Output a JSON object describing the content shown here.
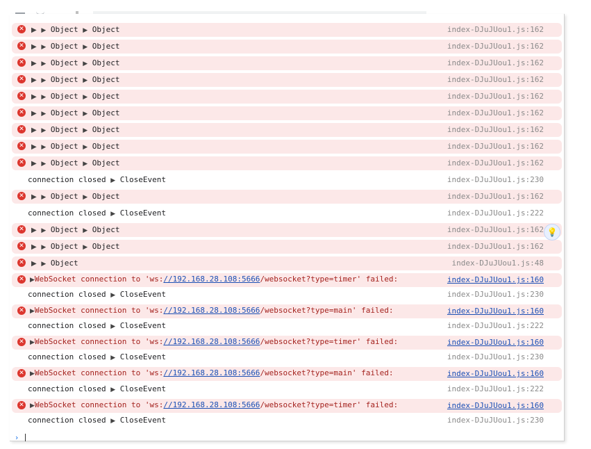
{
  "colors": {
    "error_bg": "#fce8e8",
    "error_icon": "#dc362e",
    "link": "#1a4fb5",
    "error_text": "#a4221e",
    "source_gray": "#8a8a8a"
  },
  "icons": {
    "error": "error-circle-icon",
    "expand": "expand-triangle-icon",
    "ai_assist": "ai-sparkle-icon",
    "prompt": "chevron-right-icon"
  },
  "glyphs": {
    "error": "✕",
    "expand": "▶",
    "ai": "💡",
    "prompt": "›"
  },
  "rows": [
    {
      "type": "object2",
      "a": "Object",
      "b": "Object",
      "source": "index-DJuJUou1.js:162"
    },
    {
      "type": "object2",
      "a": "Object",
      "b": "Object",
      "source": "index-DJuJUou1.js:162"
    },
    {
      "type": "object2",
      "a": "Object",
      "b": "Object",
      "source": "index-DJuJUou1.js:162"
    },
    {
      "type": "object2",
      "a": "Object",
      "b": "Object",
      "source": "index-DJuJUou1.js:162"
    },
    {
      "type": "object2",
      "a": "Object",
      "b": "Object",
      "source": "index-DJuJUou1.js:162"
    },
    {
      "type": "object2",
      "a": "Object",
      "b": "Object",
      "source": "index-DJuJUou1.js:162"
    },
    {
      "type": "object2",
      "a": "Object",
      "b": "Object",
      "source": "index-DJuJUou1.js:162"
    },
    {
      "type": "object2",
      "a": "Object",
      "b": "Object",
      "source": "index-DJuJUou1.js:162"
    },
    {
      "type": "object2",
      "a": "Object",
      "b": "Object",
      "source": "index-DJuJUou1.js:162"
    },
    {
      "type": "closed",
      "text": "connection closed",
      "event": "CloseEvent",
      "source": "index-DJuJUou1.js:230"
    },
    {
      "type": "object2",
      "a": "Object",
      "b": "Object",
      "source": "index-DJuJUou1.js:162"
    },
    {
      "type": "closed",
      "text": "connection closed",
      "event": "CloseEvent",
      "source": "index-DJuJUou1.js:222"
    },
    {
      "type": "object2",
      "a": "Object",
      "b": "Object",
      "source": "index-DJuJUou1.js:162"
    },
    {
      "type": "object2",
      "a": "Object",
      "b": "Object",
      "source": "index-DJuJUou1.js:162"
    },
    {
      "type": "object1",
      "a": "Object",
      "source": "index-DJuJUou1.js:48"
    },
    {
      "type": "ws",
      "prefix": "WebSocket connection to 'ws:",
      "link": "//192.168.28.108:5666",
      "suffix": "/websocket?type=timer' failed:",
      "source": "index-DJuJUou1.js:160"
    },
    {
      "type": "closed",
      "text": "connection closed",
      "event": "CloseEvent",
      "source": "index-DJuJUou1.js:230"
    },
    {
      "type": "ws",
      "prefix": "WebSocket connection to 'ws:",
      "link": "//192.168.28.108:5666",
      "suffix": "/websocket?type=main' failed:",
      "source": "index-DJuJUou1.js:160"
    },
    {
      "type": "closed",
      "text": "connection closed",
      "event": "CloseEvent",
      "source": "index-DJuJUou1.js:222"
    },
    {
      "type": "ws",
      "prefix": "WebSocket connection to 'ws:",
      "link": "//192.168.28.108:5666",
      "suffix": "/websocket?type=timer' failed:",
      "source": "index-DJuJUou1.js:160"
    },
    {
      "type": "closed",
      "text": "connection closed",
      "event": "CloseEvent",
      "source": "index-DJuJUou1.js:230"
    },
    {
      "type": "ws",
      "prefix": "WebSocket connection to 'ws:",
      "link": "//192.168.28.108:5666",
      "suffix": "/websocket?type=main' failed:",
      "source": "index-DJuJUou1.js:160"
    },
    {
      "type": "closed",
      "text": "connection closed",
      "event": "CloseEvent",
      "source": "index-DJuJUou1.js:222"
    },
    {
      "type": "ws",
      "prefix": "WebSocket connection to 'ws:",
      "link": "//192.168.28.108:5666",
      "suffix": "/websocket?type=timer' failed:",
      "source": "index-DJuJUou1.js:160"
    },
    {
      "type": "closed",
      "text": "connection closed",
      "event": "CloseEvent",
      "source": "index-DJuJUou1.js:230"
    }
  ]
}
